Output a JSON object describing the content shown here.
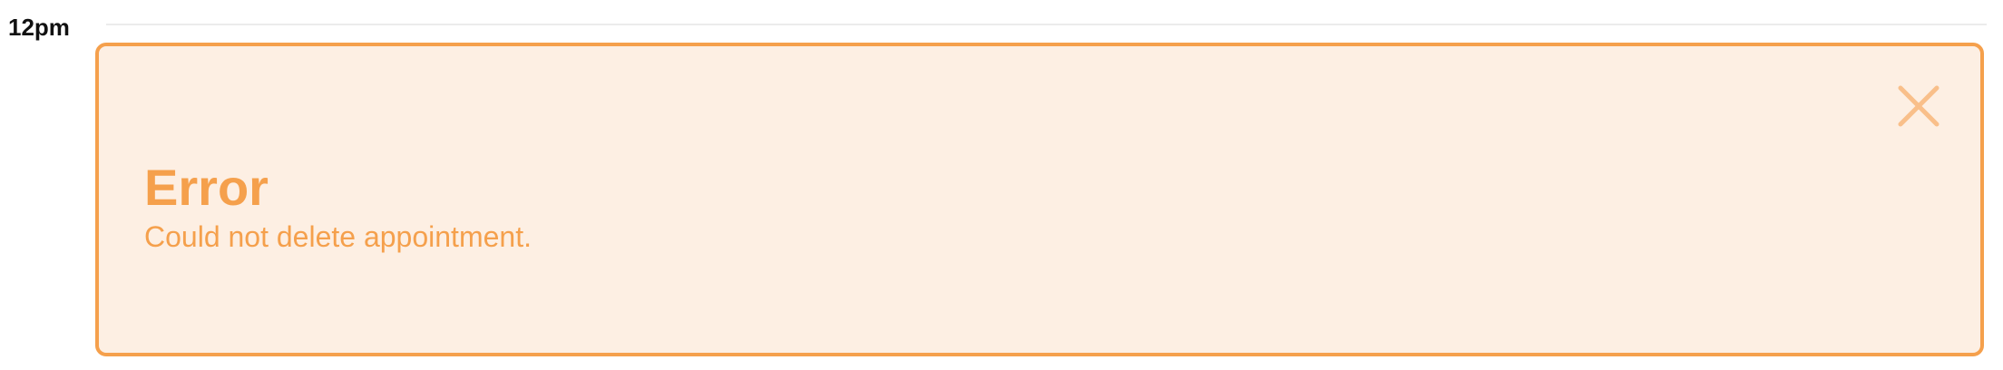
{
  "calendar": {
    "time_label": "12pm",
    "next_time_label": ""
  },
  "toast": {
    "title": "Error",
    "message": "Could not delete appointment.",
    "close_icon": "close-icon",
    "colors": {
      "background": "#fdefe3",
      "border": "#f5a04c",
      "text": "#f5a04c",
      "icon": "#f9bf8a"
    }
  }
}
